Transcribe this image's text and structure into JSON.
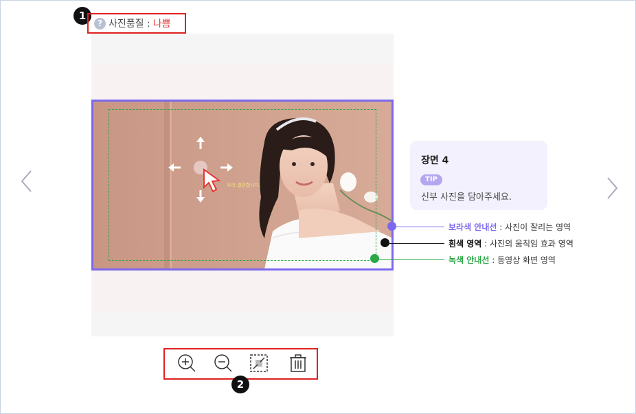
{
  "badges": {
    "one": "1",
    "two": "2"
  },
  "quality": {
    "label": "사진품질 :",
    "value": "나쁨",
    "help_icon": "question-circle-icon",
    "help_glyph": "?"
  },
  "navigation": {
    "prev_icon": "chevron-left-icon",
    "next_icon": "chevron-right-icon"
  },
  "photo": {
    "move_icon": "move-arrows-icon",
    "cursor_icon": "cursor-icon",
    "caption": "우리 결혼합니다."
  },
  "tip": {
    "scene": "장면 4",
    "badge": "TIP",
    "text": "신부 사진을 담아주세요."
  },
  "legend": [
    {
      "key": "보라색 안내선",
      "desc": " : 사진이 잘리는 영역",
      "color": "#7b68ee"
    },
    {
      "key": "흰색 영역",
      "desc": " : 사진의 움직임 효과 영역",
      "color": "#111111"
    },
    {
      "key": "녹색 안내선",
      "desc": " : 동영상 화면 영역",
      "color": "#2aa845"
    }
  ],
  "toolbar": {
    "zoom_in": "zoom-in-icon",
    "zoom_out": "zoom-out-icon",
    "fit": "fit-screen-icon",
    "delete": "trash-icon"
  }
}
